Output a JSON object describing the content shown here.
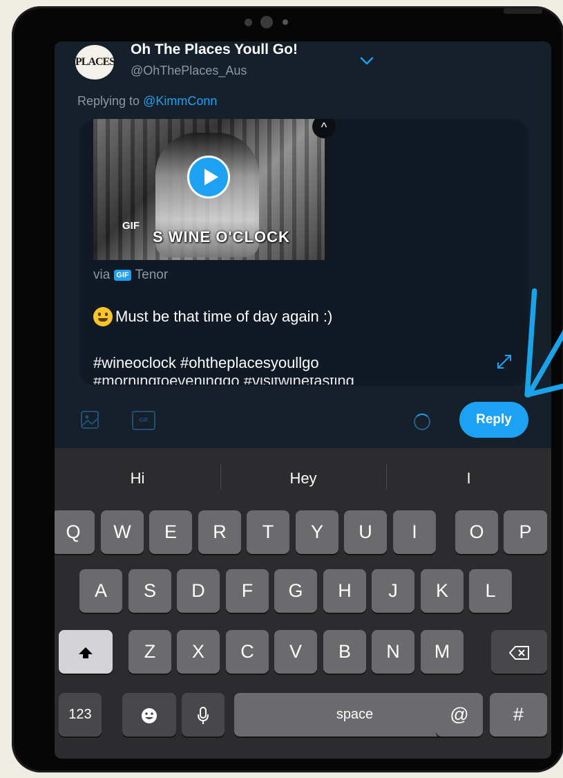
{
  "tweet_author": {
    "avatar_text": "PLACES",
    "name": "Oh The Places Youll Go!",
    "handle": "@OhThePlaces_Aus"
  },
  "replying": {
    "prefix": "Replying to",
    "mention": "@KimmConn"
  },
  "gif": {
    "badge": "GIF",
    "caption": "S WINE O'CLOCK",
    "via": "via",
    "source_badge": "GIF",
    "source": "Tenor"
  },
  "tweet": {
    "line1": "Must be that time of day again :)",
    "line2": "#wineoclock #ohtheplacesyoullgo",
    "line3": "#morningtoeveningdo #visitwinetasting"
  },
  "toolbar": {
    "gif_label": "GIF",
    "reply_label": "Reply"
  },
  "keyboard": {
    "suggestions": [
      "Hi",
      "Hey",
      "I"
    ],
    "row1": [
      "Q",
      "W",
      "E",
      "R",
      "T",
      "Y",
      "U",
      "I",
      "O",
      "P"
    ],
    "row2": [
      "A",
      "S",
      "D",
      "F",
      "G",
      "H",
      "J",
      "K",
      "L"
    ],
    "row3": [
      "Z",
      "X",
      "C",
      "V",
      "B",
      "N",
      "M"
    ],
    "numbers_label": "123",
    "space_label": "space",
    "at_label": "@",
    "hash_label": "#"
  },
  "colors": {
    "accent": "#1da1f2",
    "background": "#15202b",
    "keyboard": "#2c2c2e",
    "annotation_arrow": "#1aa3e8"
  }
}
